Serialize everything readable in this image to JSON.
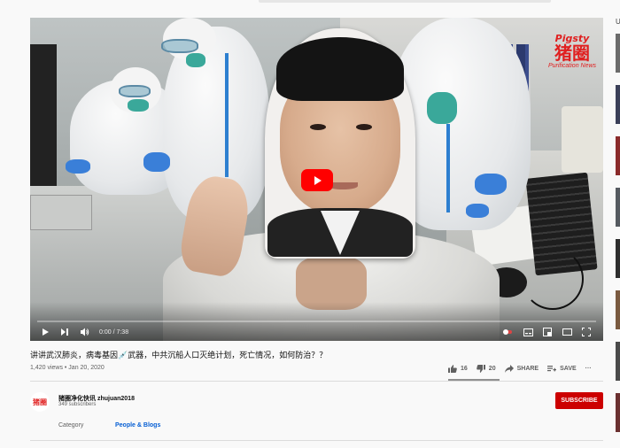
{
  "video": {
    "watermark": {
      "top": "Pigsty",
      "mid": "猪圈",
      "bottom": "Purification News"
    },
    "time": "0:00 / 7:38"
  },
  "info": {
    "title": "讲讲武汉肺炎，病毒基因💉武器，中共沉船人口灭绝计划，死亡情况，如何防治？？",
    "meta": "1,420 views • Jan 20, 2020",
    "likes": "16",
    "dislikes": "20",
    "share": "SHARE",
    "save": "SAVE",
    "more": "···"
  },
  "channel": {
    "avatar_text": "猪圈",
    "name": "猪圈净化快讯 zhujuan2018",
    "subscribers": "349 subscribers",
    "subscribe_label": "SUBSCRIBE",
    "category_label": "Category",
    "category_value": "People & Blogs"
  },
  "sidebar": {
    "header_letter": "U"
  },
  "colors": {
    "accent": "#ff0000",
    "subscribe": "#cc0000",
    "link": "#065fd4",
    "watermark": "#e02020"
  }
}
